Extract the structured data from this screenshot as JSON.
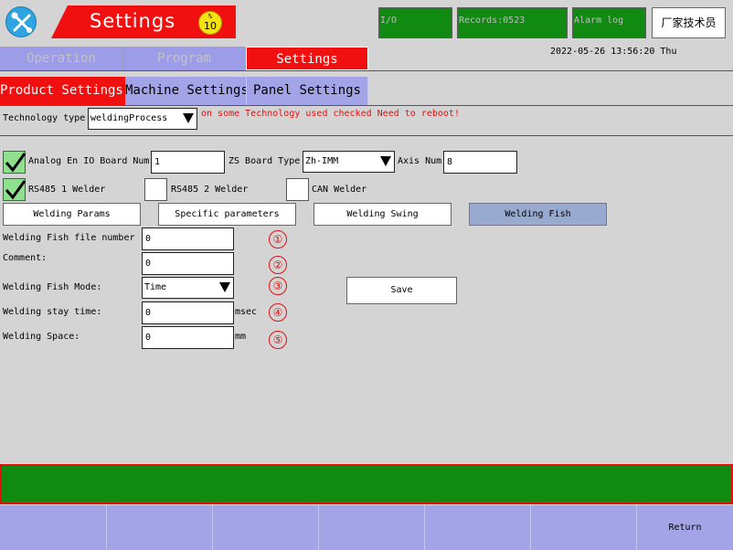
{
  "header": {
    "title": "Settings",
    "speed": {
      "symbol": "%",
      "value": "10"
    },
    "status_boxes": [
      "I/O",
      "Records:0523",
      "Alarm log"
    ],
    "login_button": "厂家技术员",
    "datetime": "2022-05-26  13:56:20  Thu"
  },
  "main_tabs": [
    {
      "label": "Operation",
      "active": false
    },
    {
      "label": "Program",
      "active": false
    },
    {
      "label": "Settings",
      "active": true
    }
  ],
  "sub_tabs": [
    {
      "label": "Product Settings",
      "active": true
    },
    {
      "label": "Machine Settings",
      "active": false
    },
    {
      "label": "Panel Settings",
      "active": false
    }
  ],
  "technology": {
    "label": "Technology type",
    "value": "weldingProcess",
    "note": "on some Technology used checked Need to reboot!"
  },
  "board": {
    "analog_label": "Analog En IO Board Num",
    "analog_checked": true,
    "analog_value": "1",
    "zs_label": "ZS Board Type",
    "zs_value": "Zh-IMM",
    "axis_label": "Axis Num",
    "axis_value": "8"
  },
  "welders": [
    {
      "label": "RS485 1 Welder",
      "checked": true
    },
    {
      "label": "RS485 2 Welder",
      "checked": false
    },
    {
      "label": "CAN Welder",
      "checked": false
    }
  ],
  "param_tabs": [
    {
      "label": "Welding Params",
      "selected": false
    },
    {
      "label": "Specific parameters",
      "selected": false
    },
    {
      "label": "Welding Swing",
      "selected": false
    },
    {
      "label": "Welding Fish",
      "selected": true
    }
  ],
  "fish_form": {
    "file_number": {
      "label": "Welding Fish file number",
      "value": "0",
      "marker": "①"
    },
    "comment": {
      "label": "Comment:",
      "value": "0",
      "marker": "②"
    },
    "mode": {
      "label": "Welding Fish Mode:",
      "value": "Time",
      "marker": "③"
    },
    "stay_time": {
      "label": "Welding stay time:",
      "value": "0",
      "unit": "msec",
      "marker": "④"
    },
    "space": {
      "label": "Welding Space:",
      "value": "0",
      "unit": "mm",
      "marker": "⑤"
    }
  },
  "save_button": "Save",
  "bottom_bar": {
    "return_label": "Return"
  },
  "colors": {
    "background": "#d4d4d4",
    "accent_red": "#f01010",
    "status_green": "#118a11",
    "tab_lavender": "#9c9ce8",
    "check_green": "#8ee08e",
    "selected_button": "#99aad0",
    "icon_blue": "#2fa4e0",
    "speed_yellow": "#f2e312"
  },
  "icons": {
    "tools": "wrench-screwdriver-icon",
    "dropdown": "triangle-down-icon",
    "check": "checkmark-icon"
  }
}
